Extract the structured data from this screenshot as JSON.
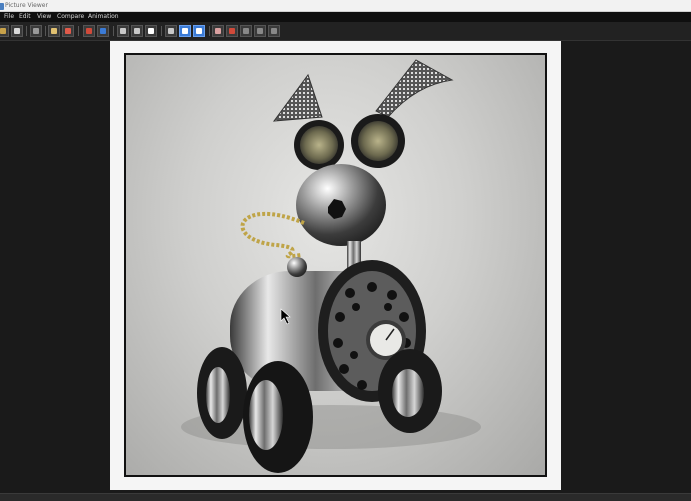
{
  "window": {
    "title": "Picture Viewer"
  },
  "menu": {
    "items": [
      "File",
      "Edit",
      "View",
      "Compare",
      "Animation"
    ]
  },
  "toolbar": {
    "buttons": [
      {
        "name": "open-file-icon",
        "color": "#c8a24a"
      },
      {
        "name": "save-image-icon",
        "color": "#d9d9d9"
      },
      {
        "name": "copy-icon",
        "color": "#9a9a9a"
      },
      {
        "name": "zoom-in-icon",
        "color": "#e0c070"
      },
      {
        "name": "zoom-fit-icon",
        "color": "#e05a4a"
      },
      {
        "name": "color-channel-icon",
        "color": "#d04a3a"
      },
      {
        "name": "layer-icon",
        "color": "#3b7bd6"
      },
      {
        "name": "history-icon",
        "color": "#c8c8c8"
      },
      {
        "name": "display-icon",
        "color": "#c8c8c8"
      },
      {
        "name": "region-render-icon",
        "color": "#ffffff"
      },
      {
        "name": "stereo-icon",
        "color": "#c8c8c8"
      },
      {
        "name": "compare-a-icon",
        "color": "#ffffff"
      },
      {
        "name": "compare-b-icon",
        "color": "#ffffff"
      },
      {
        "name": "text-icon",
        "color": "#d9a0a0"
      },
      {
        "name": "stop-icon",
        "color": "#d04a3a"
      },
      {
        "name": "grid-icon",
        "color": "#888888"
      },
      {
        "name": "split-icon",
        "color": "#888888"
      },
      {
        "name": "filter-icon",
        "color": "#888888"
      }
    ]
  },
  "viewport": {
    "image": "rendered-robot-dog-image"
  }
}
